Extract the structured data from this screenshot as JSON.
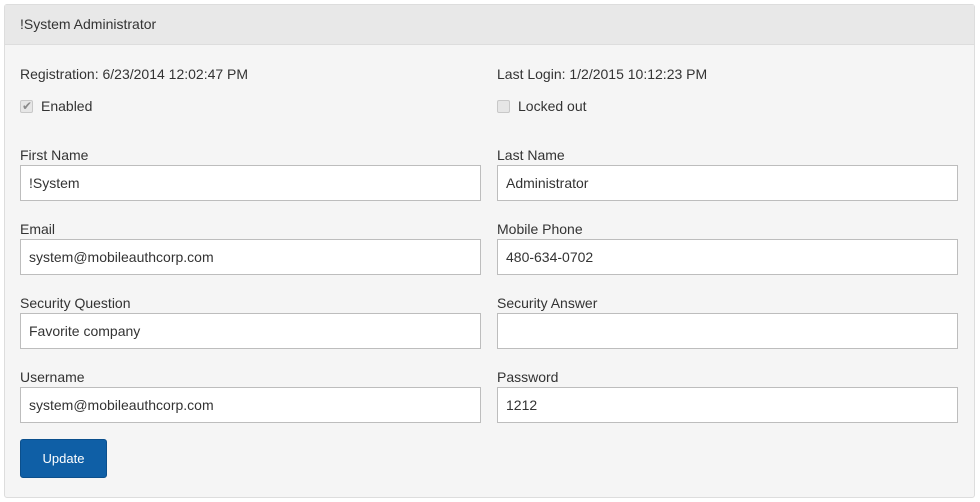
{
  "panel": {
    "title": "!System Administrator"
  },
  "meta": {
    "registration": "Registration: 6/23/2014 12:02:47 PM",
    "last_login": "Last Login: 1/2/2015 10:12:23 PM"
  },
  "flags": {
    "enabled": {
      "label": "Enabled",
      "checked": true
    },
    "locked_out": {
      "label": "Locked out",
      "checked": false
    }
  },
  "fields": {
    "first_name": {
      "label": "First Name",
      "value": "!System"
    },
    "last_name": {
      "label": "Last Name",
      "value": "Administrator"
    },
    "email": {
      "label": "Email",
      "value": "system@mobileauthcorp.com"
    },
    "mobile_phone": {
      "label": "Mobile Phone",
      "value": "480-634-0702"
    },
    "security_question": {
      "label": "Security Question",
      "value": "Favorite company"
    },
    "security_answer": {
      "label": "Security Answer",
      "value": ""
    },
    "username": {
      "label": "Username",
      "value": "system@mobileauthcorp.com"
    },
    "password": {
      "label": "Password",
      "value": "1212"
    }
  },
  "actions": {
    "update_label": "Update"
  },
  "colors": {
    "primary_button": "#0f5fa6",
    "panel_heading": "#e8e8e8",
    "panel_body": "#f5f5f5"
  }
}
